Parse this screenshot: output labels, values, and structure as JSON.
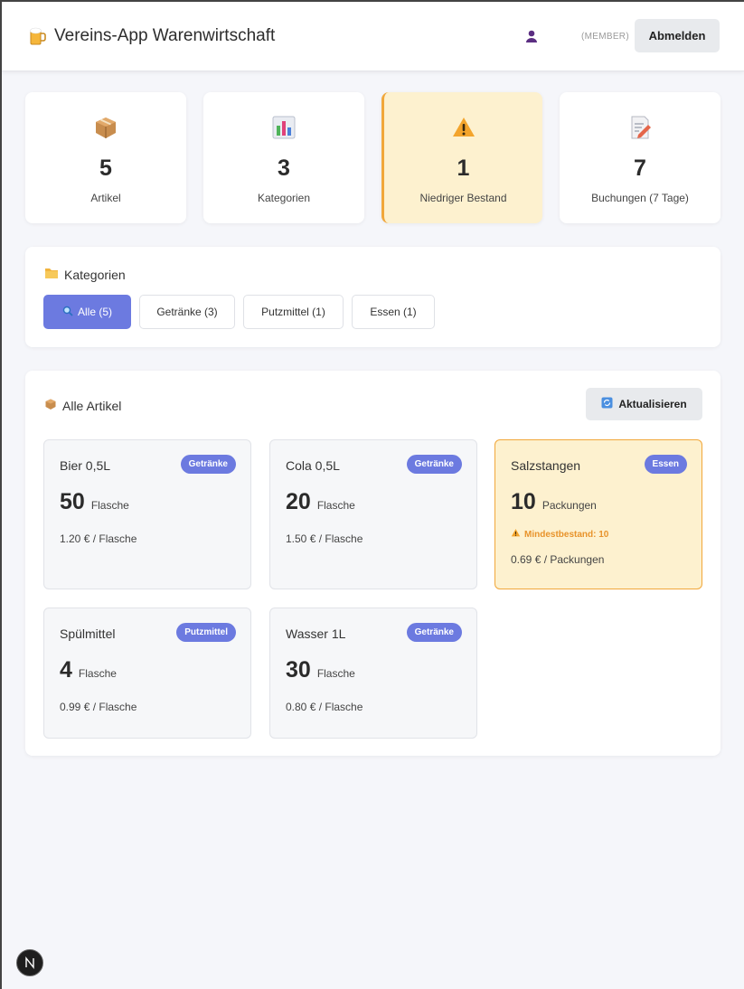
{
  "header": {
    "title": "Vereins-App Warenwirtschaft",
    "role": "(MEMBER)",
    "logout_label": "Abmelden",
    "logo_icon": "beer-mug-icon",
    "user_icon": "user-icon"
  },
  "stats": [
    {
      "icon": "package-icon",
      "value": "5",
      "label": "Artikel"
    },
    {
      "icon": "bar-chart-icon",
      "value": "3",
      "label": "Kategorien"
    },
    {
      "icon": "warning-icon",
      "value": "1",
      "label": "Niedriger Bestand",
      "highlight": true
    },
    {
      "icon": "memo-icon",
      "value": "7",
      "label": "Buchungen (7 Tage)"
    }
  ],
  "categories": {
    "title": "Kategorien",
    "filters": [
      {
        "label": "Alle (5)",
        "active": true
      },
      {
        "label": "Getränke (3)"
      },
      {
        "label": "Putzmittel (1)"
      },
      {
        "label": "Essen (1)"
      }
    ]
  },
  "articles": {
    "title": "Alle Artikel",
    "refresh_label": "Aktualisieren",
    "items": [
      {
        "name": "Bier 0,5L",
        "category": "Getränke",
        "qty": "50",
        "unit": "Flasche",
        "price": "1.20 € / Flasche"
      },
      {
        "name": "Cola 0,5L",
        "category": "Getränke",
        "qty": "20",
        "unit": "Flasche",
        "price": "1.50 € / Flasche"
      },
      {
        "name": "Salzstangen",
        "category": "Essen",
        "qty": "10",
        "unit": "Packungen",
        "price": "0.69 € / Packungen",
        "min_warning": "Mindestbestand: 10",
        "low": true
      },
      {
        "name": "Spülmittel",
        "category": "Putzmittel",
        "qty": "4",
        "unit": "Flasche",
        "price": "0.99 € / Flasche"
      },
      {
        "name": "Wasser 1L",
        "category": "Getränke",
        "qty": "30",
        "unit": "Flasche",
        "price": "0.80 € / Flasche"
      }
    ]
  },
  "colors": {
    "accent": "#6c7ae0",
    "warning_bg": "#fdf1cf",
    "warning_border": "#f1a73a",
    "warning_text": "#e8932b"
  },
  "dev_badge": {
    "letter": "N"
  }
}
